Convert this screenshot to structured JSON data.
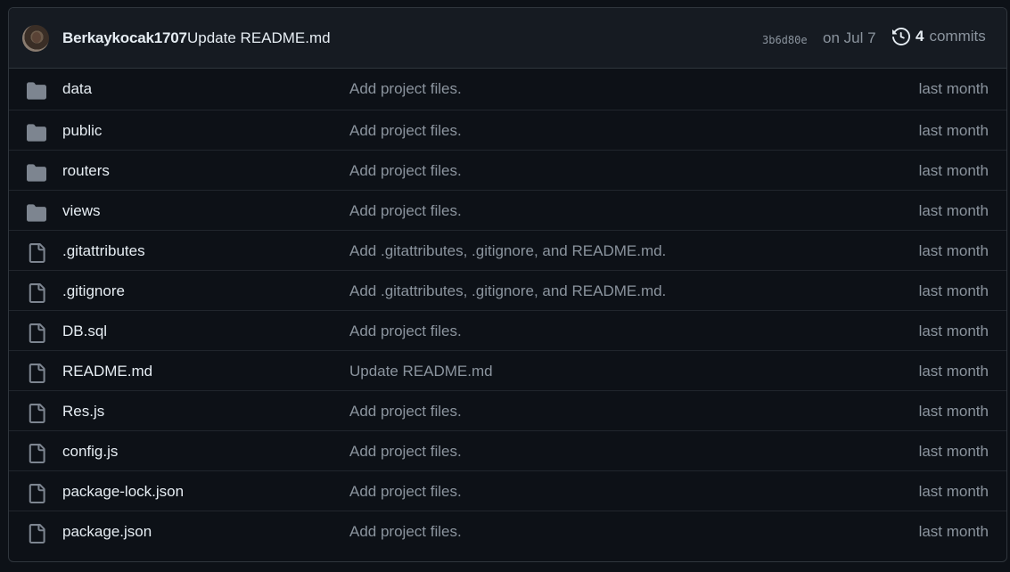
{
  "latest_commit": {
    "author": "Berkaykocak1707",
    "message": "Update README.md",
    "sha": "3b6d80e",
    "date": "on Jul 7",
    "commit_count": "4",
    "commits_label": "commits",
    "history_icon": "history-icon"
  },
  "files": [
    {
      "name": "data",
      "type": "folder",
      "message": "Add project files.",
      "age": "last month"
    },
    {
      "name": "public",
      "type": "folder",
      "message": "Add project files.",
      "age": "last month"
    },
    {
      "name": "routers",
      "type": "folder",
      "message": "Add project files.",
      "age": "last month"
    },
    {
      "name": "views",
      "type": "folder",
      "message": "Add project files.",
      "age": "last month"
    },
    {
      "name": ".gitattributes",
      "type": "file",
      "message": "Add .gitattributes, .gitignore, and README.md.",
      "age": "last month"
    },
    {
      "name": ".gitignore",
      "type": "file",
      "message": "Add .gitattributes, .gitignore, and README.md.",
      "age": "last month"
    },
    {
      "name": "DB.sql",
      "type": "file",
      "message": "Add project files.",
      "age": "last month"
    },
    {
      "name": "README.md",
      "type": "file",
      "message": "Update README.md",
      "age": "last month"
    },
    {
      "name": "Res.js",
      "type": "file",
      "message": "Add project files.",
      "age": "last month"
    },
    {
      "name": "config.js",
      "type": "file",
      "message": "Add project files.",
      "age": "last month"
    },
    {
      "name": "package-lock.json",
      "type": "file",
      "message": "Add project files.",
      "age": "last month"
    },
    {
      "name": "package.json",
      "type": "file",
      "message": "Add project files.",
      "age": "last month"
    }
  ],
  "colors": {
    "background": "#0d1117",
    "header_background": "#161b22",
    "border": "#30363d",
    "text_primary": "#e6edf3",
    "text_muted": "#8b949e",
    "icon": "#7d8590"
  }
}
